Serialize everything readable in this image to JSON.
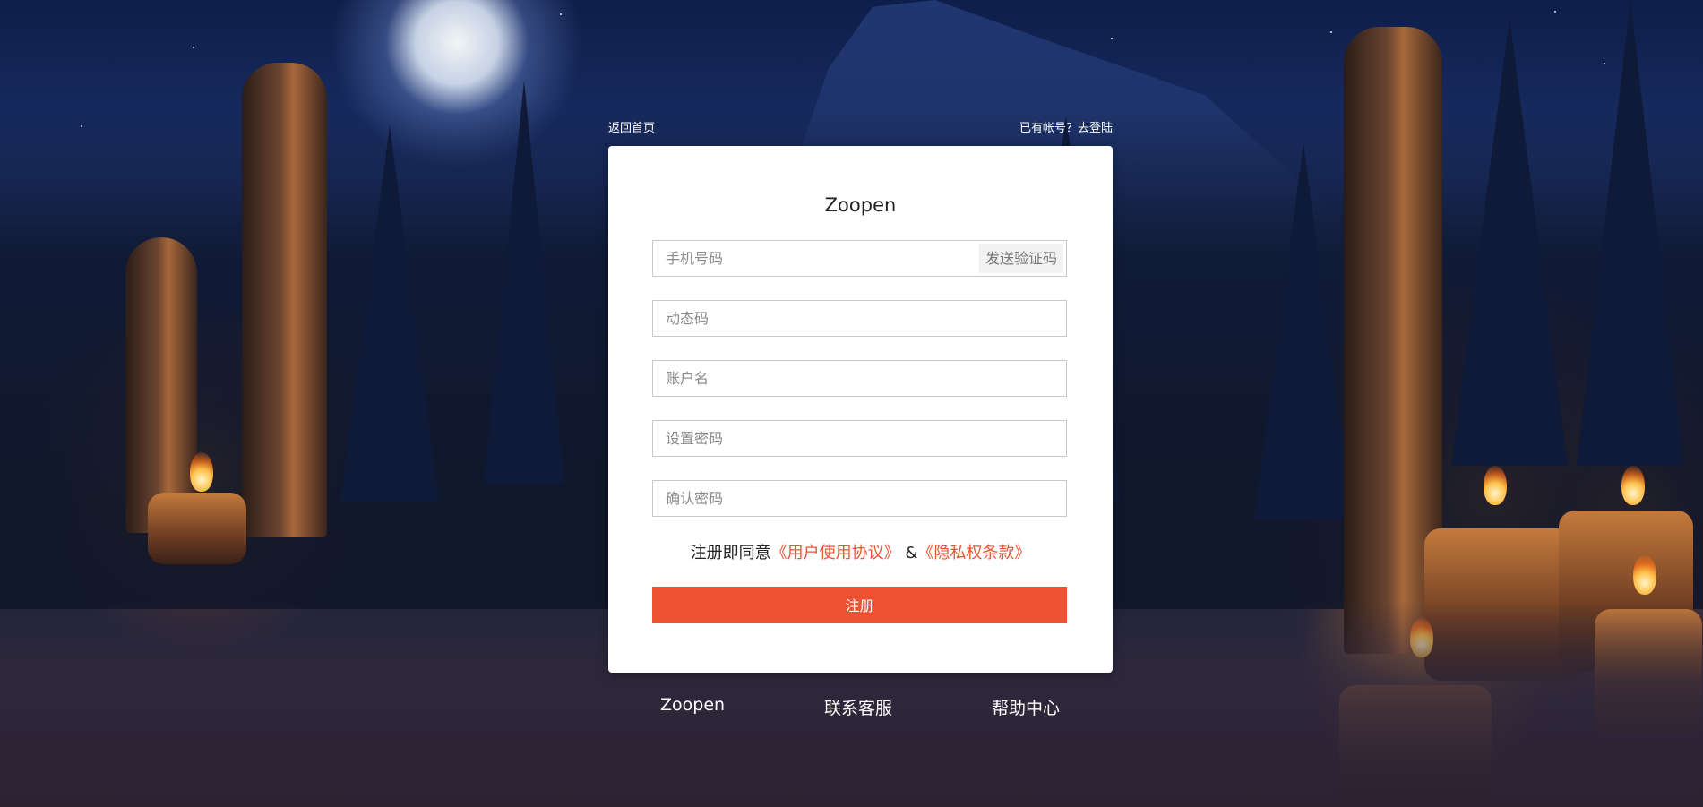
{
  "top_links": {
    "back_home": "返回首页",
    "have_account": "已有帐号？去登陆"
  },
  "form": {
    "brand": "Zoopen",
    "phone_placeholder": "手机号码",
    "send_code_label": "发送验证码",
    "code_placeholder": "动态码",
    "account_placeholder": "账户名",
    "password_placeholder": "设置密码",
    "confirm_placeholder": "确认密码",
    "agree_prefix": "注册即同意",
    "user_agreement": "《用户使用协议》",
    "amp": "&",
    "privacy_terms": "《隐私权条款》",
    "submit_label": "注册"
  },
  "footer": {
    "brand": "Zoopen",
    "contact": "联系客服",
    "help": "帮助中心"
  },
  "colors": {
    "accent": "#ee5233",
    "link": "#e95333"
  }
}
